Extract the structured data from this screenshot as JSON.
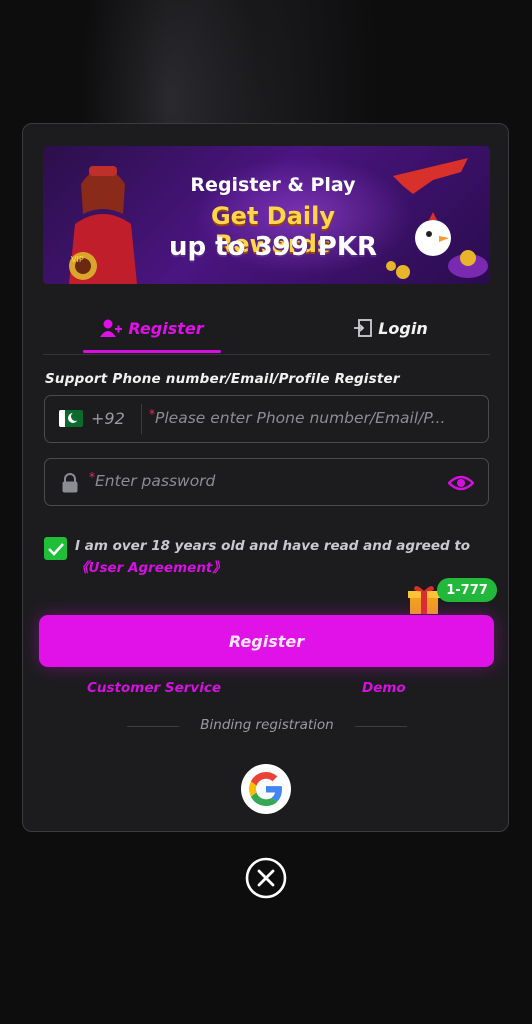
{
  "banner": {
    "line1": "Register & Play",
    "line2": "Get Daily Rewards",
    "line3": "up to 399 PKR"
  },
  "tabs": {
    "register": "Register",
    "login": "Login"
  },
  "form": {
    "support_label": "Support Phone number/Email/Profile Register",
    "country_code": "+92",
    "phone_placeholder": "Please enter Phone number/Email/P...",
    "password_placeholder": "Enter password",
    "required_mark": "*"
  },
  "agreement": {
    "text": "I am over 18 years old and have read and agreed to",
    "link": "《User Agreement》",
    "checked": true
  },
  "promo_badge": "1-777",
  "register_button": "Register",
  "links": {
    "customer_service": "Customer Service",
    "demo": "Demo"
  },
  "binding_label": "Binding registration",
  "colors": {
    "accent": "#e012e8",
    "check": "#1fbf3a",
    "modal_bg": "#1c1c1e"
  },
  "icons": {
    "register_tab": "user-plus-icon",
    "login_tab": "door-login-icon",
    "flag": "pakistan-flag-icon",
    "lock": "lock-icon",
    "eye": "eye-icon",
    "gift": "gift-icon",
    "google": "google-icon",
    "close": "close-icon"
  }
}
